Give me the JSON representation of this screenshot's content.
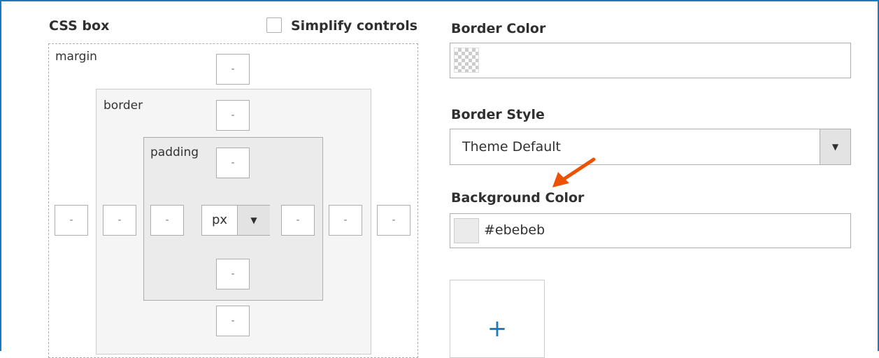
{
  "css_box": {
    "title": "CSS box",
    "simplify_label": "Simplify controls",
    "simplify_checked": false,
    "margin_label": "margin",
    "border_label": "border",
    "padding_label": "padding",
    "margin": {
      "top": "-",
      "bottom": "-",
      "left": "-",
      "right": "-"
    },
    "border": {
      "top": "-",
      "left": "-",
      "right": "-"
    },
    "padding": {
      "top": "-",
      "bottom": "-",
      "left": "-",
      "right": "-"
    },
    "unit": {
      "value": "px",
      "arrow": "▼"
    }
  },
  "right_panel": {
    "border_color_label": "Border Color",
    "border_color_value": "",
    "border_style_label": "Border Style",
    "border_style_value": "Theme Default",
    "border_style_arrow": "▼",
    "background_color_label": "Background Color",
    "background_color_value": "#ebebeb",
    "background_swatch_color": "#ebebeb",
    "add_image_plus": "+"
  },
  "annotation": {
    "arrow_color": "#eb5202",
    "arrow_icon": "arrow-pointer-icon"
  },
  "colors": {
    "accent": "#1979c3",
    "annotation_orange": "#eb5202"
  }
}
